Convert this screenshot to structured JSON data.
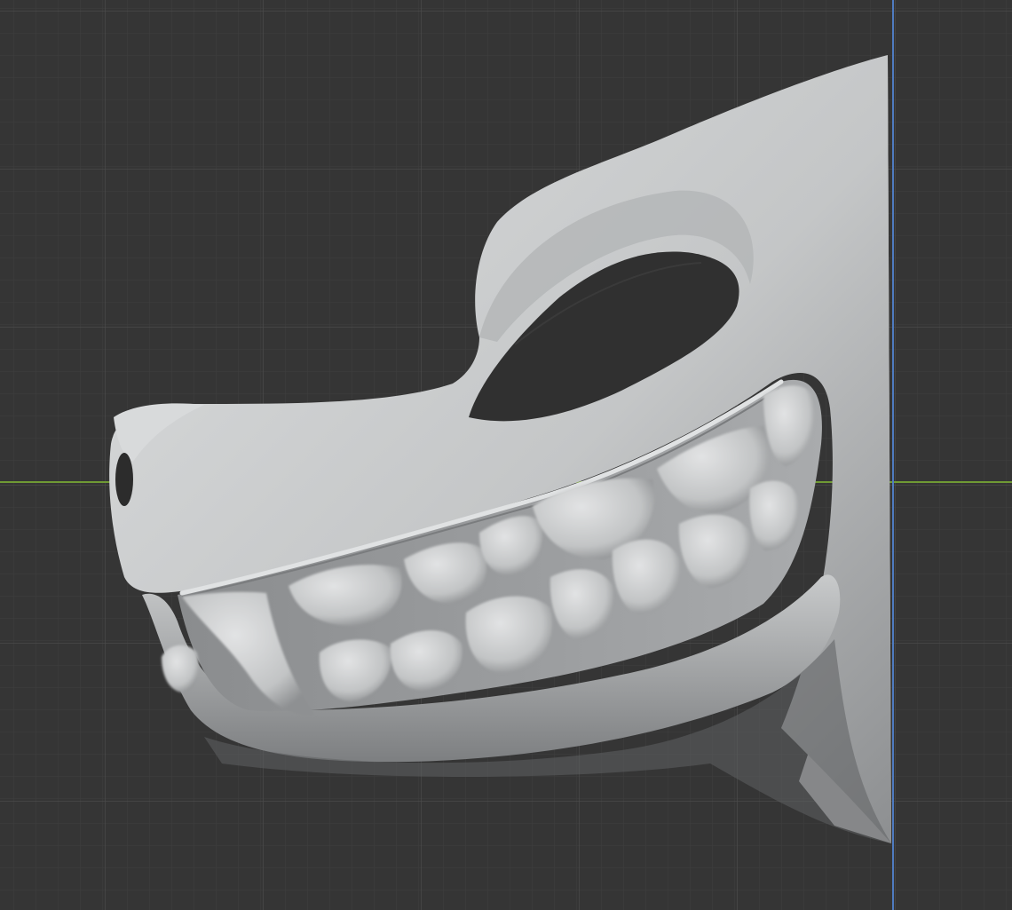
{
  "viewport": {
    "background": "#353535",
    "grid_minor_color": "#3f3f3f",
    "grid_major_color": "#4a4a4a",
    "axis_x_color": "#6f9a34",
    "axis_y_color": "#4f7bc0"
  },
  "model": {
    "subject": "sculpted-muzzle",
    "surface_color": "#c9cbcc",
    "shadow_color": "#6e7072"
  }
}
